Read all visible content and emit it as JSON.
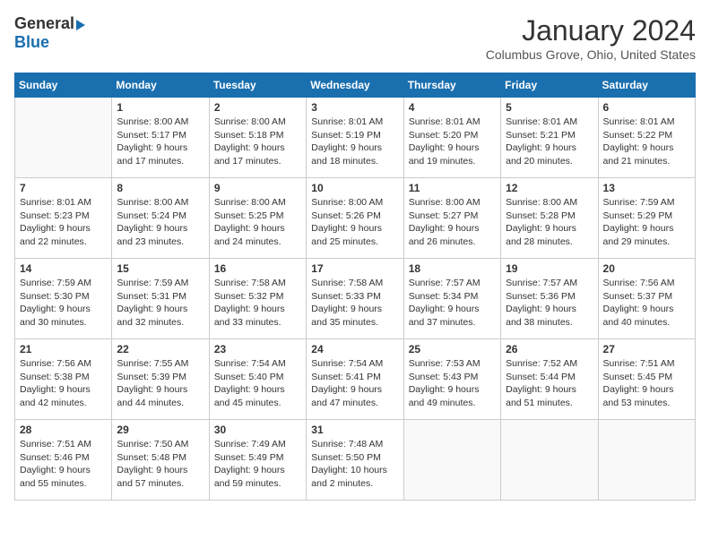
{
  "header": {
    "logo_general": "General",
    "logo_blue": "Blue",
    "month_year": "January 2024",
    "location": "Columbus Grove, Ohio, United States"
  },
  "weekdays": [
    "Sunday",
    "Monday",
    "Tuesday",
    "Wednesday",
    "Thursday",
    "Friday",
    "Saturday"
  ],
  "weeks": [
    [
      {
        "day": "",
        "sunrise": "",
        "sunset": "",
        "daylight": ""
      },
      {
        "day": "1",
        "sunrise": "Sunrise: 8:00 AM",
        "sunset": "Sunset: 5:17 PM",
        "daylight": "Daylight: 9 hours and 17 minutes."
      },
      {
        "day": "2",
        "sunrise": "Sunrise: 8:00 AM",
        "sunset": "Sunset: 5:18 PM",
        "daylight": "Daylight: 9 hours and 17 minutes."
      },
      {
        "day": "3",
        "sunrise": "Sunrise: 8:01 AM",
        "sunset": "Sunset: 5:19 PM",
        "daylight": "Daylight: 9 hours and 18 minutes."
      },
      {
        "day": "4",
        "sunrise": "Sunrise: 8:01 AM",
        "sunset": "Sunset: 5:20 PM",
        "daylight": "Daylight: 9 hours and 19 minutes."
      },
      {
        "day": "5",
        "sunrise": "Sunrise: 8:01 AM",
        "sunset": "Sunset: 5:21 PM",
        "daylight": "Daylight: 9 hours and 20 minutes."
      },
      {
        "day": "6",
        "sunrise": "Sunrise: 8:01 AM",
        "sunset": "Sunset: 5:22 PM",
        "daylight": "Daylight: 9 hours and 21 minutes."
      }
    ],
    [
      {
        "day": "7",
        "sunrise": "Sunrise: 8:01 AM",
        "sunset": "Sunset: 5:23 PM",
        "daylight": "Daylight: 9 hours and 22 minutes."
      },
      {
        "day": "8",
        "sunrise": "Sunrise: 8:00 AM",
        "sunset": "Sunset: 5:24 PM",
        "daylight": "Daylight: 9 hours and 23 minutes."
      },
      {
        "day": "9",
        "sunrise": "Sunrise: 8:00 AM",
        "sunset": "Sunset: 5:25 PM",
        "daylight": "Daylight: 9 hours and 24 minutes."
      },
      {
        "day": "10",
        "sunrise": "Sunrise: 8:00 AM",
        "sunset": "Sunset: 5:26 PM",
        "daylight": "Daylight: 9 hours and 25 minutes."
      },
      {
        "day": "11",
        "sunrise": "Sunrise: 8:00 AM",
        "sunset": "Sunset: 5:27 PM",
        "daylight": "Daylight: 9 hours and 26 minutes."
      },
      {
        "day": "12",
        "sunrise": "Sunrise: 8:00 AM",
        "sunset": "Sunset: 5:28 PM",
        "daylight": "Daylight: 9 hours and 28 minutes."
      },
      {
        "day": "13",
        "sunrise": "Sunrise: 7:59 AM",
        "sunset": "Sunset: 5:29 PM",
        "daylight": "Daylight: 9 hours and 29 minutes."
      }
    ],
    [
      {
        "day": "14",
        "sunrise": "Sunrise: 7:59 AM",
        "sunset": "Sunset: 5:30 PM",
        "daylight": "Daylight: 9 hours and 30 minutes."
      },
      {
        "day": "15",
        "sunrise": "Sunrise: 7:59 AM",
        "sunset": "Sunset: 5:31 PM",
        "daylight": "Daylight: 9 hours and 32 minutes."
      },
      {
        "day": "16",
        "sunrise": "Sunrise: 7:58 AM",
        "sunset": "Sunset: 5:32 PM",
        "daylight": "Daylight: 9 hours and 33 minutes."
      },
      {
        "day": "17",
        "sunrise": "Sunrise: 7:58 AM",
        "sunset": "Sunset: 5:33 PM",
        "daylight": "Daylight: 9 hours and 35 minutes."
      },
      {
        "day": "18",
        "sunrise": "Sunrise: 7:57 AM",
        "sunset": "Sunset: 5:34 PM",
        "daylight": "Daylight: 9 hours and 37 minutes."
      },
      {
        "day": "19",
        "sunrise": "Sunrise: 7:57 AM",
        "sunset": "Sunset: 5:36 PM",
        "daylight": "Daylight: 9 hours and 38 minutes."
      },
      {
        "day": "20",
        "sunrise": "Sunrise: 7:56 AM",
        "sunset": "Sunset: 5:37 PM",
        "daylight": "Daylight: 9 hours and 40 minutes."
      }
    ],
    [
      {
        "day": "21",
        "sunrise": "Sunrise: 7:56 AM",
        "sunset": "Sunset: 5:38 PM",
        "daylight": "Daylight: 9 hours and 42 minutes."
      },
      {
        "day": "22",
        "sunrise": "Sunrise: 7:55 AM",
        "sunset": "Sunset: 5:39 PM",
        "daylight": "Daylight: 9 hours and 44 minutes."
      },
      {
        "day": "23",
        "sunrise": "Sunrise: 7:54 AM",
        "sunset": "Sunset: 5:40 PM",
        "daylight": "Daylight: 9 hours and 45 minutes."
      },
      {
        "day": "24",
        "sunrise": "Sunrise: 7:54 AM",
        "sunset": "Sunset: 5:41 PM",
        "daylight": "Daylight: 9 hours and 47 minutes."
      },
      {
        "day": "25",
        "sunrise": "Sunrise: 7:53 AM",
        "sunset": "Sunset: 5:43 PM",
        "daylight": "Daylight: 9 hours and 49 minutes."
      },
      {
        "day": "26",
        "sunrise": "Sunrise: 7:52 AM",
        "sunset": "Sunset: 5:44 PM",
        "daylight": "Daylight: 9 hours and 51 minutes."
      },
      {
        "day": "27",
        "sunrise": "Sunrise: 7:51 AM",
        "sunset": "Sunset: 5:45 PM",
        "daylight": "Daylight: 9 hours and 53 minutes."
      }
    ],
    [
      {
        "day": "28",
        "sunrise": "Sunrise: 7:51 AM",
        "sunset": "Sunset: 5:46 PM",
        "daylight": "Daylight: 9 hours and 55 minutes."
      },
      {
        "day": "29",
        "sunrise": "Sunrise: 7:50 AM",
        "sunset": "Sunset: 5:48 PM",
        "daylight": "Daylight: 9 hours and 57 minutes."
      },
      {
        "day": "30",
        "sunrise": "Sunrise: 7:49 AM",
        "sunset": "Sunset: 5:49 PM",
        "daylight": "Daylight: 9 hours and 59 minutes."
      },
      {
        "day": "31",
        "sunrise": "Sunrise: 7:48 AM",
        "sunset": "Sunset: 5:50 PM",
        "daylight": "Daylight: 10 hours and 2 minutes."
      },
      {
        "day": "",
        "sunrise": "",
        "sunset": "",
        "daylight": ""
      },
      {
        "day": "",
        "sunrise": "",
        "sunset": "",
        "daylight": ""
      },
      {
        "day": "",
        "sunrise": "",
        "sunset": "",
        "daylight": ""
      }
    ]
  ]
}
